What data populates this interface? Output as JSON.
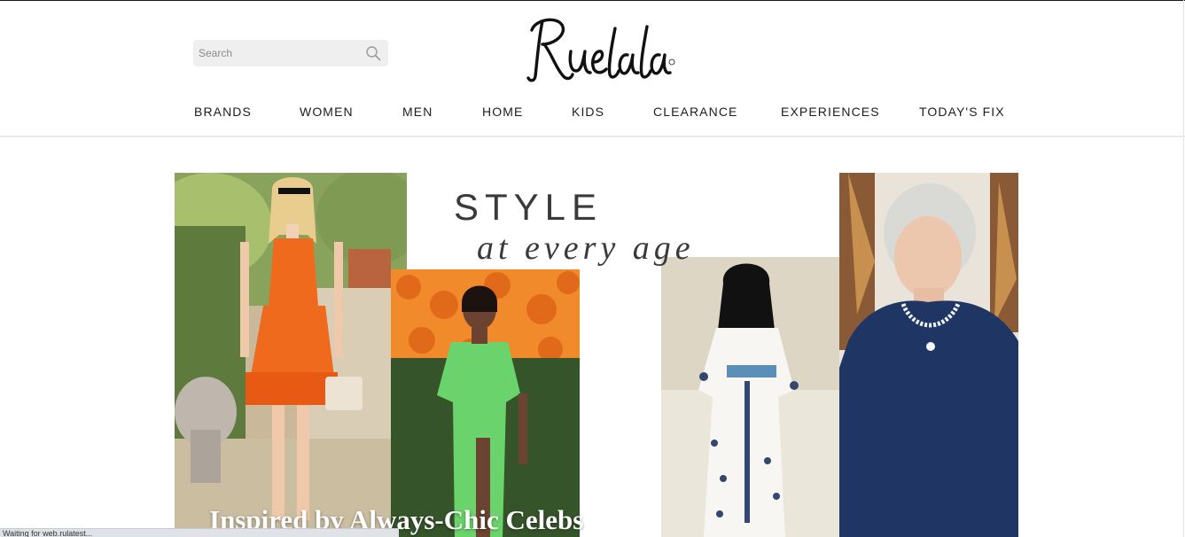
{
  "header": {
    "search": {
      "placeholder": "Search",
      "value": ""
    },
    "logo_text": "Rue la la",
    "nav": [
      {
        "label": "BRANDS"
      },
      {
        "label": "WOMEN"
      },
      {
        "label": "MEN"
      },
      {
        "label": "HOME"
      },
      {
        "label": "KIDS"
      },
      {
        "label": "CLEARANCE"
      },
      {
        "label": "EXPERIENCES"
      },
      {
        "label": "TODAY'S FIX"
      }
    ]
  },
  "hero": {
    "title": "STYLE",
    "subtitle": "at every age",
    "caption": "Inspired by Always-Chic Celebs"
  },
  "status_bar": {
    "text": "Waiting for web.rulatest..."
  },
  "colors": {
    "nav_text": "#1d1d1d",
    "search_bg": "#efefef",
    "orange_dress": "#f06a1e",
    "green_dress": "#6bd36b",
    "navy_dress": "#1f3564"
  },
  "icons": [
    "search-icon",
    "logo"
  ]
}
